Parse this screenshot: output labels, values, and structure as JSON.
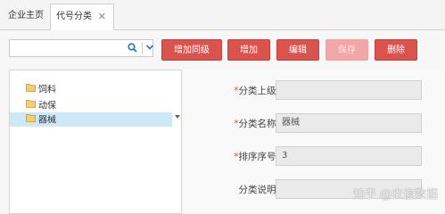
{
  "tabs": [
    {
      "label": "企业主页"
    },
    {
      "label": "代号分类"
    }
  ],
  "tab_close": "✕",
  "search": {
    "placeholder": "",
    "value": ""
  },
  "toolbar": {
    "add_sibling_label": "增加同级",
    "add_label": "增加",
    "edit_label": "编辑",
    "save_label": "保存",
    "delete_label": "删除"
  },
  "tree": {
    "items": [
      {
        "label": "饲料"
      },
      {
        "label": "动保"
      },
      {
        "label": "器械"
      }
    ],
    "selected": "器械"
  },
  "form": {
    "parent": {
      "label": "分类上级：",
      "value": ""
    },
    "name": {
      "label": "分类名称：",
      "value": "器械"
    },
    "order": {
      "label": "排序序号：",
      "value": "3"
    },
    "desc": {
      "label": "分类说明：",
      "value": ""
    },
    "required_mark": "*"
  },
  "watermark": "知乎 @农信数据",
  "colors": {
    "accent": "#d9534f",
    "accent_disabled": "#f0a7a5",
    "selection": "#cde8f6",
    "folder": "#e6b64c"
  }
}
